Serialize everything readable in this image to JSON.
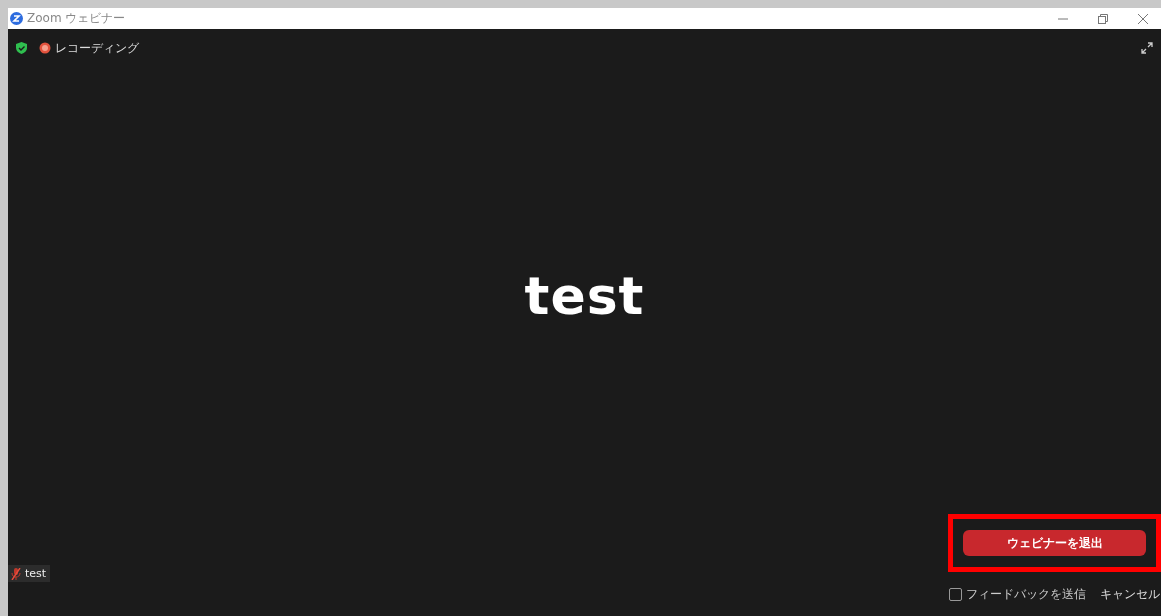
{
  "window": {
    "title": "Zoom ウェビナー"
  },
  "status": {
    "recording_label": "レコーディング"
  },
  "stage": {
    "name": "test"
  },
  "name_tag": {
    "label": "test",
    "muted": true
  },
  "leave_panel": {
    "button": "ウェビナーを退出",
    "highlighted": true,
    "feedback": {
      "label": "フィードバックを送信",
      "checked": false
    },
    "cancel": "キャンセル"
  }
}
